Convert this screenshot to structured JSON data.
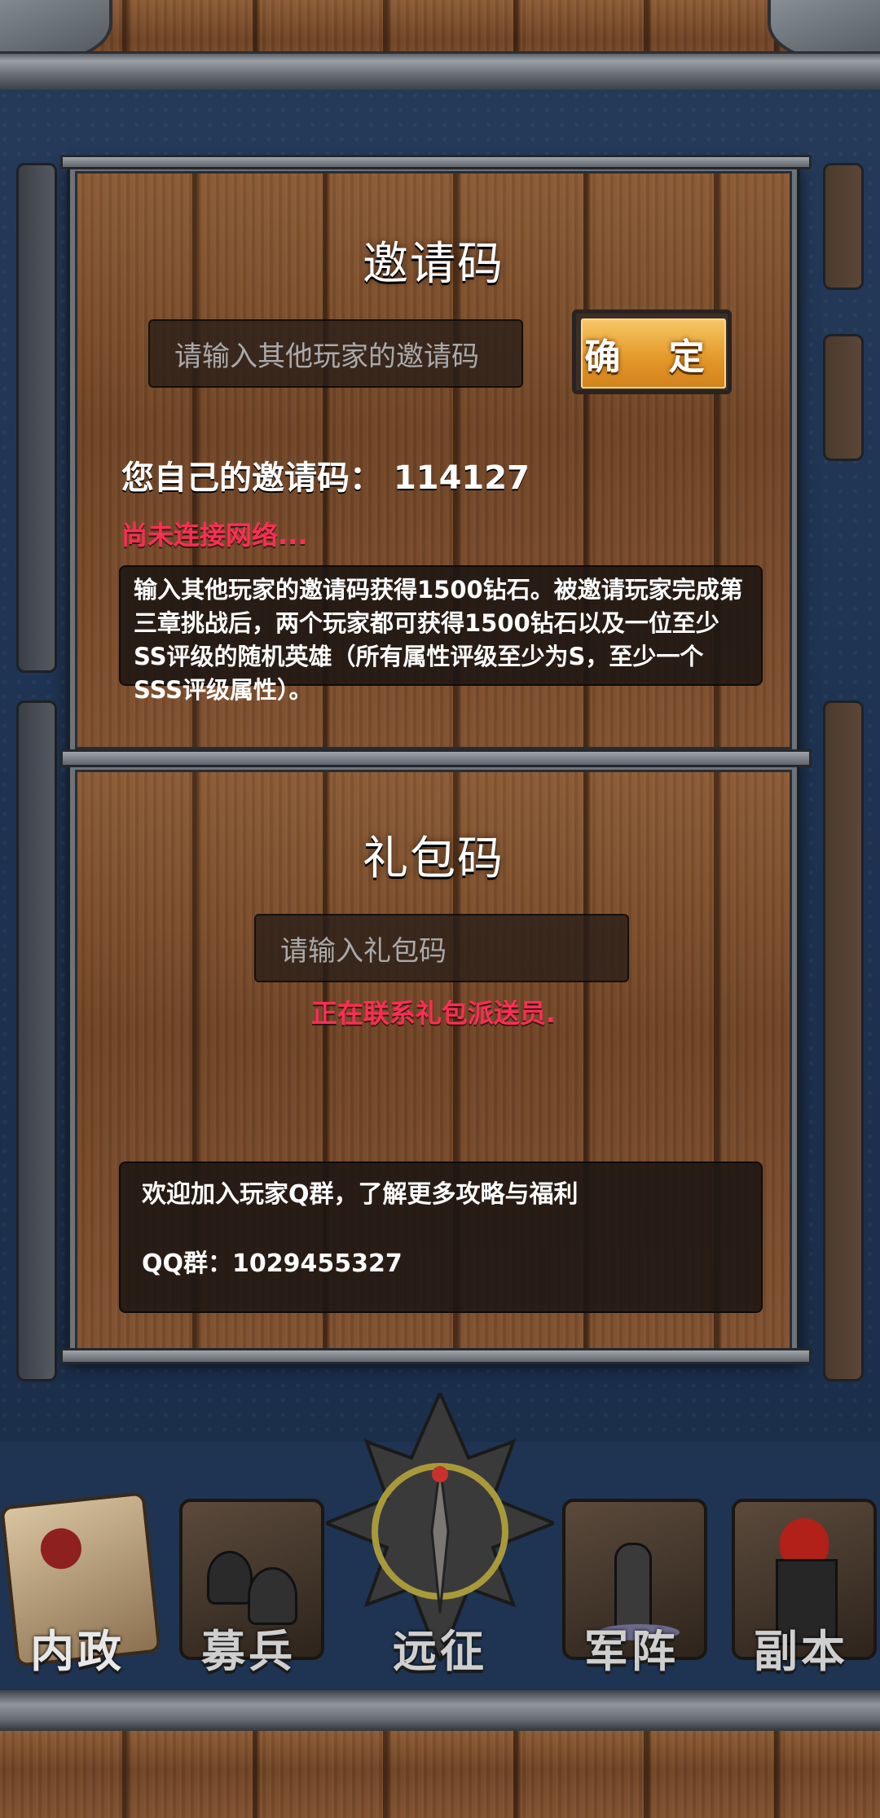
{
  "invite": {
    "title": "邀请码",
    "input_placeholder": "请输入其他玩家的邀请码",
    "confirm_label": "确 定",
    "own_code_label": "您自己的邀请码：",
    "own_code_value": "114127",
    "status": "尚未连接网络...",
    "description": "输入其他玩家的邀请码获得1500钻石。被邀请玩家完成第三章挑战后，两个玩家都可获得1500钻石以及一位至少SS评级的随机英雄（所有属性评级至少为S，至少一个SSS评级属性）。"
  },
  "gift": {
    "title": "礼包码",
    "input_placeholder": "请输入礼包码",
    "status": "正在联系礼包派送员.",
    "group_line1": "欢迎加入玩家Q群，了解更多攻略与福利",
    "group_line2": "QQ群：1029455327"
  },
  "nav": {
    "items": [
      "内政",
      "募兵",
      "远征",
      "军阵",
      "副本"
    ],
    "active": "内政"
  },
  "colors": {
    "accent_red": "#ff2d55",
    "confirm_orange": "#e59a2a",
    "background": "#1f3452"
  }
}
